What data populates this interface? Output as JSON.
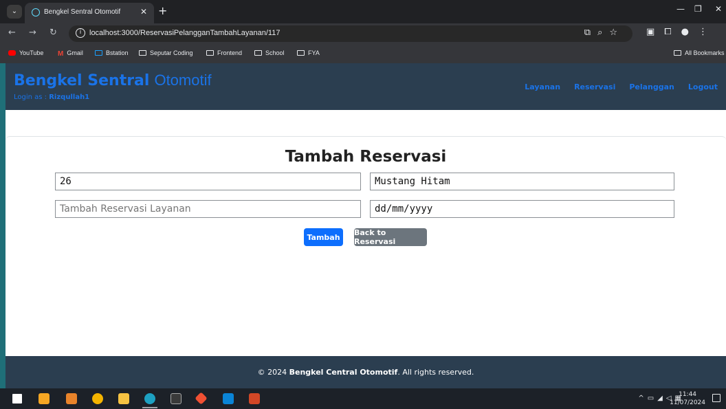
{
  "browser": {
    "tab_title": "Bengkel Sentral Otomotif",
    "tab_close": "✕",
    "new_tab": "+",
    "url": "localhost:3000/ReservasiPelangganTambahLayanan/117",
    "bookmarks": [
      "YouTube",
      "Gmail",
      "Bstation",
      "Seputar Coding",
      "Frontend",
      "School",
      "FYA"
    ],
    "all_bookmarks": "All Bookmarks"
  },
  "app": {
    "brand_bold": "Bengkel Sentral",
    "brand_light": "Otomotif",
    "login_prefix": "Login as : ",
    "login_user": "Rizqullah1",
    "menu": [
      "Layanan",
      "Reservasi",
      "Pelanggan",
      "Logout"
    ]
  },
  "form": {
    "title": "Tambah Reservasi",
    "field1_value": "26",
    "field2_value": "Mustang Hitam",
    "field3_placeholder": "Tambah Reservasi Layanan",
    "field4_value": "dd/mm/yyyy",
    "submit_label": "Tambah",
    "back_label": "Back to Reservasi"
  },
  "footer": {
    "prefix": "© 2024 ",
    "brand": "Bengkel Central Otomotif",
    "suffix": ". All rights reserved."
  },
  "taskbar": {
    "time": "11:44",
    "date": "11/07/2024"
  },
  "colors": {
    "header_bg": "#2b3e50",
    "accent": "#1a73e8",
    "primary_button": "#0d6efd",
    "secondary_button": "#6c757d"
  }
}
